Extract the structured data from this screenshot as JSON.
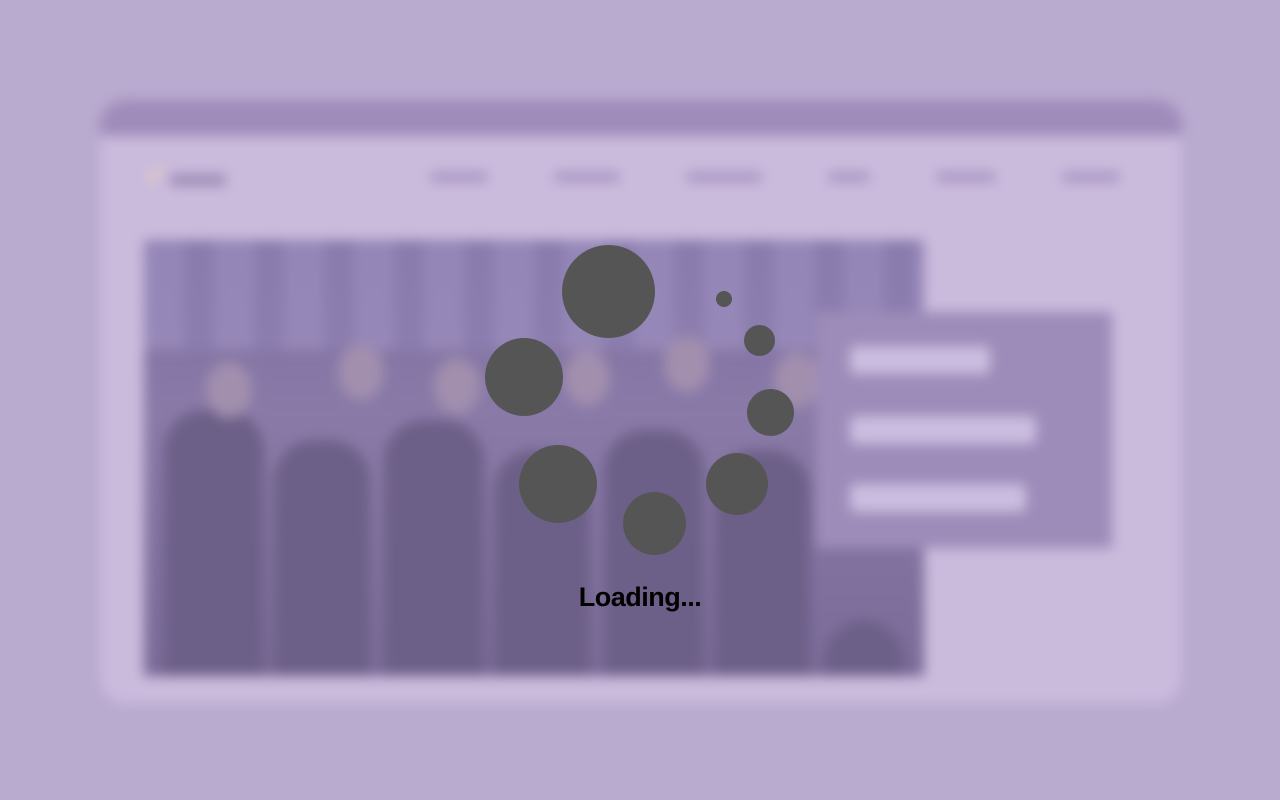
{
  "overlay": {
    "loading_label": "Loading..."
  },
  "colors": {
    "backdrop": "#b9aad0",
    "spinner_dot": "#555555",
    "loading_text": "#000000"
  },
  "icons": {
    "spinner": "loading-spinner-icon"
  }
}
